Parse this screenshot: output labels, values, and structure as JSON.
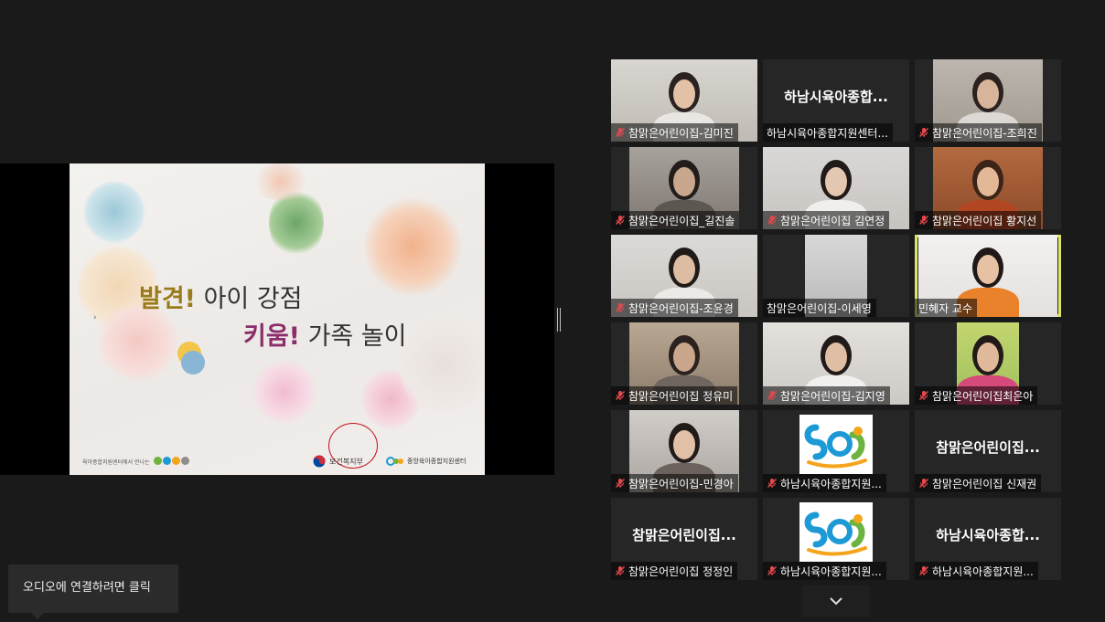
{
  "slide": {
    "line1_highlight": "발견!",
    "line1_text": " 아이 강점",
    "line2_highlight": "키움!",
    "line2_text": " 가족 놀이",
    "footer_left_text": "육아종합지원센터에서 만나는",
    "ministry_label": "보건복지부",
    "center_label": "중앙육아종합지원센터"
  },
  "participants": [
    {
      "name": "참맑은어린이집-김미진",
      "muted": true,
      "tile": "video"
    },
    {
      "name": "하남시육아종합지원센터...",
      "muted": false,
      "tile": "name",
      "display": "하남시육아종합..."
    },
    {
      "name": "참맑은어린이집-조희진",
      "muted": true,
      "tile": "video"
    },
    {
      "name": "참맑은어린이집_길진솔",
      "muted": true,
      "tile": "video"
    },
    {
      "name": "참맑은어린이집 김연정",
      "muted": true,
      "tile": "video"
    },
    {
      "name": "참맑은어린이집 황지선",
      "muted": true,
      "tile": "video"
    },
    {
      "name": "참맑은어린이집-조윤경",
      "muted": true,
      "tile": "video"
    },
    {
      "name": "참맑은어린이집-이세영",
      "muted": false,
      "tile": "video"
    },
    {
      "name": "민혜자 교수",
      "muted": false,
      "tile": "video",
      "active": true
    },
    {
      "name": "참맑은어린이집 정유미",
      "muted": true,
      "tile": "video"
    },
    {
      "name": "참맑은어린이집-김지영",
      "muted": true,
      "tile": "video"
    },
    {
      "name": "참맑은어린이집최은아",
      "muted": true,
      "tile": "video"
    },
    {
      "name": "참맑은어린이집-민경아",
      "muted": true,
      "tile": "video"
    },
    {
      "name": "하남시육아종합지원...",
      "muted": true,
      "tile": "logo"
    },
    {
      "name": "참맑은어린이집 신재권",
      "muted": true,
      "tile": "name",
      "display": "참맑은어린이집..."
    },
    {
      "name": "참맑은어린이집 정정인",
      "muted": true,
      "tile": "name",
      "display": "참맑은어린이집..."
    },
    {
      "name": "하남시육아종합지원...",
      "muted": true,
      "tile": "logo"
    },
    {
      "name": "하남시육아종합지원...",
      "muted": true,
      "tile": "name",
      "display": "하남시육아종합..."
    }
  ],
  "tooltip": {
    "text": "오디오에 연결하려면 클릭"
  },
  "colors": {
    "muted_mic": "#e5484d",
    "active_border": "#e0e36a",
    "background": "#1a1a1a"
  }
}
